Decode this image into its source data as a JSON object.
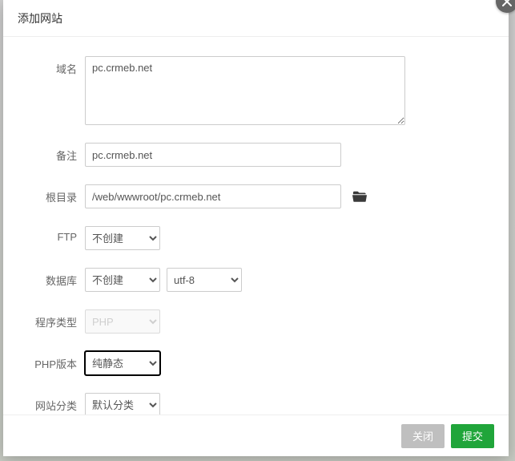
{
  "dialog": {
    "title": "添加网站"
  },
  "form": {
    "domain": {
      "label": "域名",
      "value": "pc.crmeb.net"
    },
    "remark": {
      "label": "备注",
      "value": "pc.crmeb.net"
    },
    "root": {
      "label": "根目录",
      "value": "/web/wwwroot/pc.crmeb.net"
    },
    "ftp": {
      "label": "FTP",
      "selected": "不创建"
    },
    "database": {
      "label": "数据库",
      "selected": "不创建",
      "charset": "utf-8"
    },
    "program": {
      "label": "程序类型",
      "selected": "PHP"
    },
    "php": {
      "label": "PHP版本",
      "selected": "纯静态"
    },
    "category": {
      "label": "网站分类",
      "selected": "默认分类"
    }
  },
  "footer": {
    "close": "关闭",
    "submit": "提交"
  }
}
